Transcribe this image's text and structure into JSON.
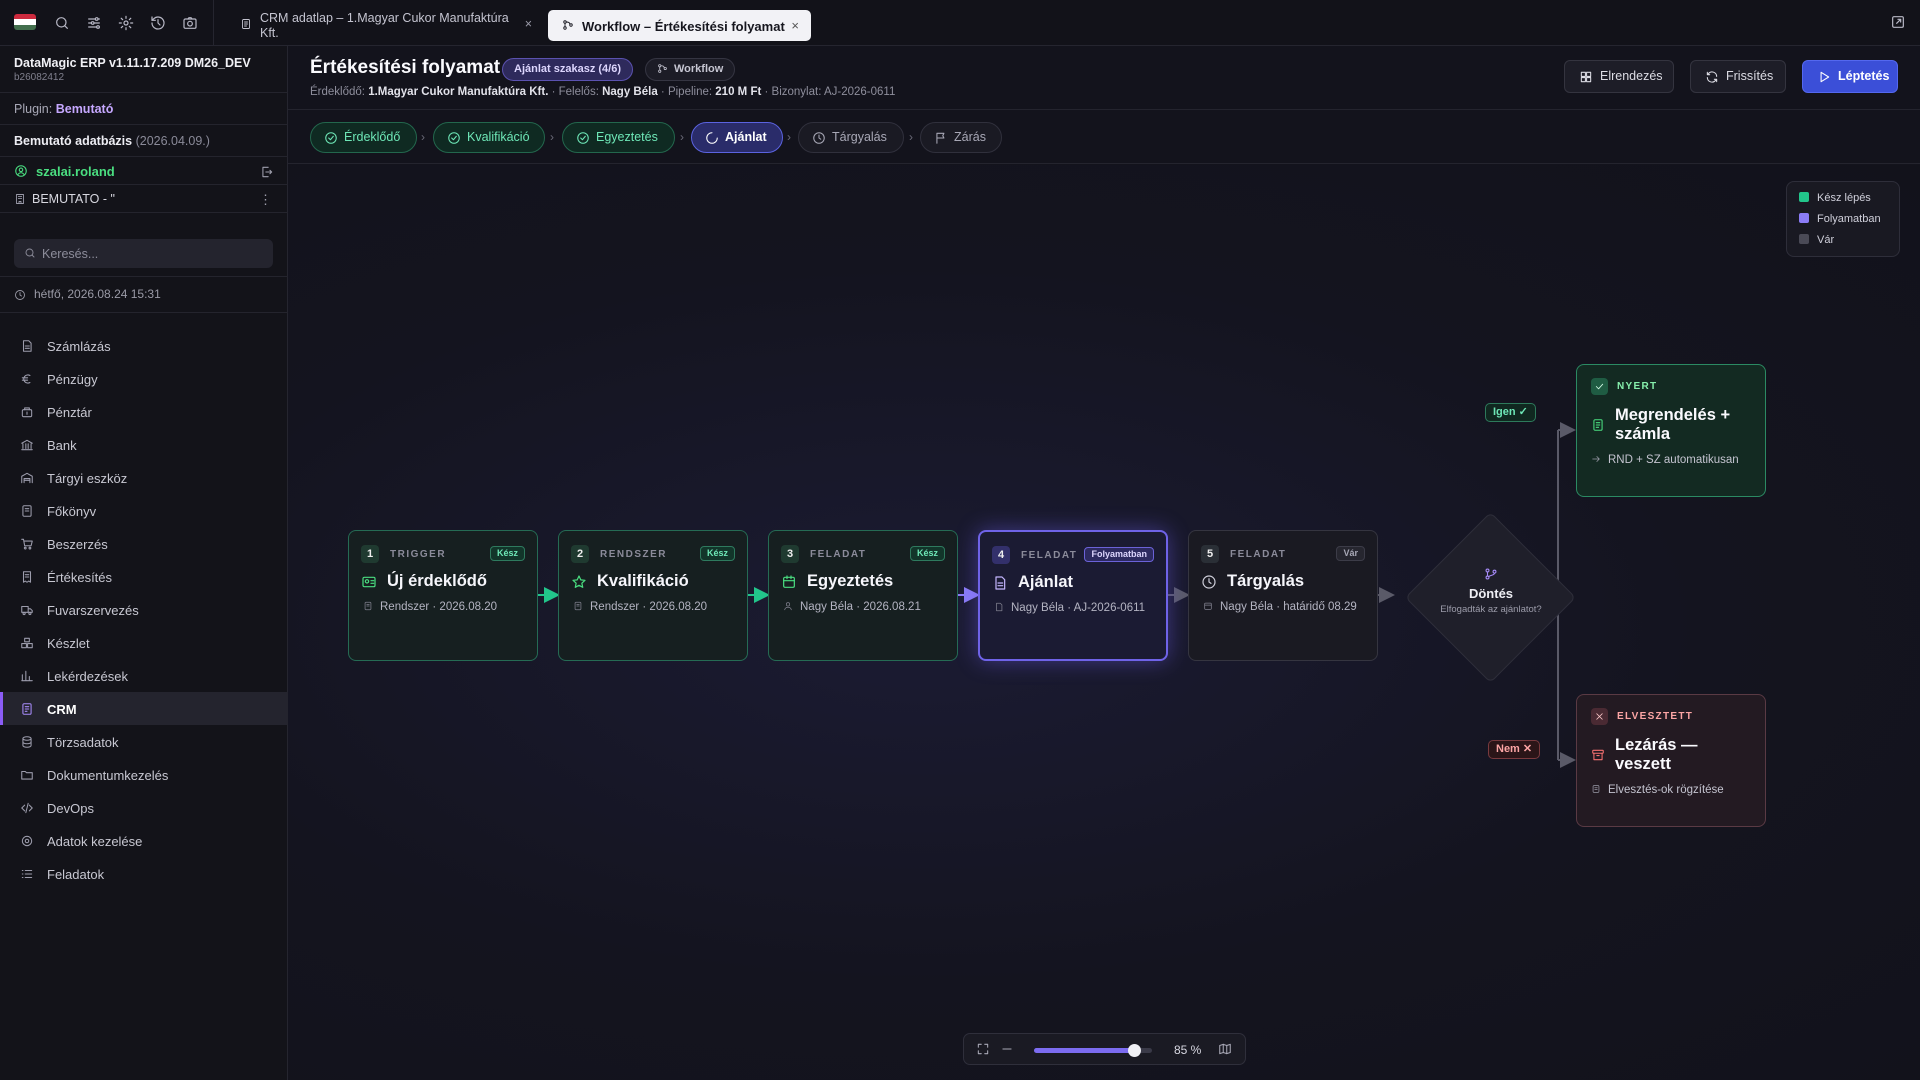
{
  "topbar": {
    "tabs": [
      {
        "label": "CRM adatlap – 1.Magyar Cukor Manufaktúra Kft.",
        "close": "×"
      },
      {
        "label": "Workflow – Értékesítési folyamat",
        "close": "×"
      }
    ],
    "icons": [
      "flag-hu",
      "search-icon",
      "sliders-icon",
      "gear-icon",
      "history-icon",
      "camera-icon",
      "expand-icon"
    ]
  },
  "sidebar": {
    "app_name": "DataMagic ERP v1.11.17.209 DM26_DEV",
    "app_build": "b26082412",
    "plugin_label": "Plugin:",
    "plugin_value": "Bemutató",
    "db_name": "Bemutató adatbázis",
    "db_date": "(2026.04.09.)",
    "user": "szalai.roland",
    "company": "BEMUTATO - \"",
    "search_placeholder": "Keresés...",
    "datetime": "hétfő, 2026.08.24 15:31",
    "nav": [
      {
        "label": "Számlázás",
        "icon": "file-icon"
      },
      {
        "label": "Pénzügy",
        "icon": "euro-icon"
      },
      {
        "label": "Pénztár",
        "icon": "cashbox-icon"
      },
      {
        "label": "Bank",
        "icon": "bank-icon"
      },
      {
        "label": "Tárgyi eszköz",
        "icon": "warehouse-icon"
      },
      {
        "label": "Főkönyv",
        "icon": "ledger-icon"
      },
      {
        "label": "Beszerzés",
        "icon": "cart-icon"
      },
      {
        "label": "Értékesítés",
        "icon": "receipt-icon"
      },
      {
        "label": "Fuvarszervezés",
        "icon": "truck-icon"
      },
      {
        "label": "Készlet",
        "icon": "boxes-icon"
      },
      {
        "label": "Lekérdezések",
        "icon": "chart-icon"
      },
      {
        "label": "CRM",
        "icon": "crm-icon",
        "active": true
      },
      {
        "label": "Törzsadatok",
        "icon": "database-icon"
      },
      {
        "label": "Dokumentumkezelés",
        "icon": "folder-icon"
      },
      {
        "label": "DevOps",
        "icon": "code-icon"
      },
      {
        "label": "Adatok kezelése",
        "icon": "settings-icon"
      },
      {
        "label": "Feladatok",
        "icon": "list-icon"
      }
    ]
  },
  "header": {
    "title": "Értékesítési folyamat",
    "stage_pill": "Ajánlat szakasz (4/6)",
    "workflow_pill": "Workflow",
    "meta": {
      "lead_label": "Érdeklődő:",
      "lead_value": "1.Magyar Cukor Manufaktúra Kft.",
      "owner_label": "Felelős:",
      "owner_value": "Nagy Béla",
      "pipeline_label": "Pipeline:",
      "pipeline_value": "210 M Ft",
      "doc_label": "Bizonylat:",
      "doc_value": "AJ-2026-0611"
    },
    "buttons": {
      "layout": "Elrendezés",
      "refresh": "Frissítés",
      "step": "Léptetés"
    }
  },
  "stepper": [
    {
      "label": "Érdeklődő",
      "state": "done"
    },
    {
      "label": "Kvalifikáció",
      "state": "done"
    },
    {
      "label": "Egyeztetés",
      "state": "done"
    },
    {
      "label": "Ajánlat",
      "state": "active"
    },
    {
      "label": "Tárgyalás",
      "state": "wait"
    },
    {
      "label": "Zárás",
      "state": "wait"
    }
  ],
  "legend": [
    {
      "label": "Kész lépés",
      "color": "#22c58b"
    },
    {
      "label": "Folyamatban",
      "color": "#8b7cf6"
    },
    {
      "label": "Vár",
      "color": "#4a4a56"
    }
  ],
  "nodes": [
    {
      "num": "1",
      "kind": "TRIGGER",
      "badge": "Kész",
      "name": "Új érdeklődő",
      "sub": "Rendszer · 2026.08.20",
      "state": "done"
    },
    {
      "num": "2",
      "kind": "RENDSZER",
      "badge": "Kész",
      "name": "Kvalifikáció",
      "sub": "Rendszer · 2026.08.20",
      "state": "done"
    },
    {
      "num": "3",
      "kind": "FELADAT",
      "badge": "Kész",
      "name": "Egyeztetés",
      "sub": "Nagy Béla · 2026.08.21",
      "state": "done"
    },
    {
      "num": "4",
      "kind": "FELADAT",
      "badge": "Folyamatban",
      "name": "Ajánlat",
      "sub": "Nagy Béla · AJ-2026-0611",
      "state": "run"
    },
    {
      "num": "5",
      "kind": "FELADAT",
      "badge": "Vár",
      "name": "Tárgyalás",
      "sub": "Nagy Béla · határidő 08.29",
      "state": "wait"
    }
  ],
  "decision": {
    "title": "Döntés",
    "subtitle": "Elfogadták az ajánlatot?"
  },
  "branches": {
    "yes": "Igen ✓",
    "no": "Nem ✕"
  },
  "outcomes": {
    "won": {
      "tag": "NYERT",
      "title": "Megrendelés + számla",
      "sub": "RND + SZ automatikusan"
    },
    "lost": {
      "tag": "ELVESZTETT",
      "title": "Lezárás — veszett",
      "sub": "Elvesztés-ok rögzítése"
    }
  },
  "zoom": {
    "label": "85 %",
    "level": 0.85
  }
}
